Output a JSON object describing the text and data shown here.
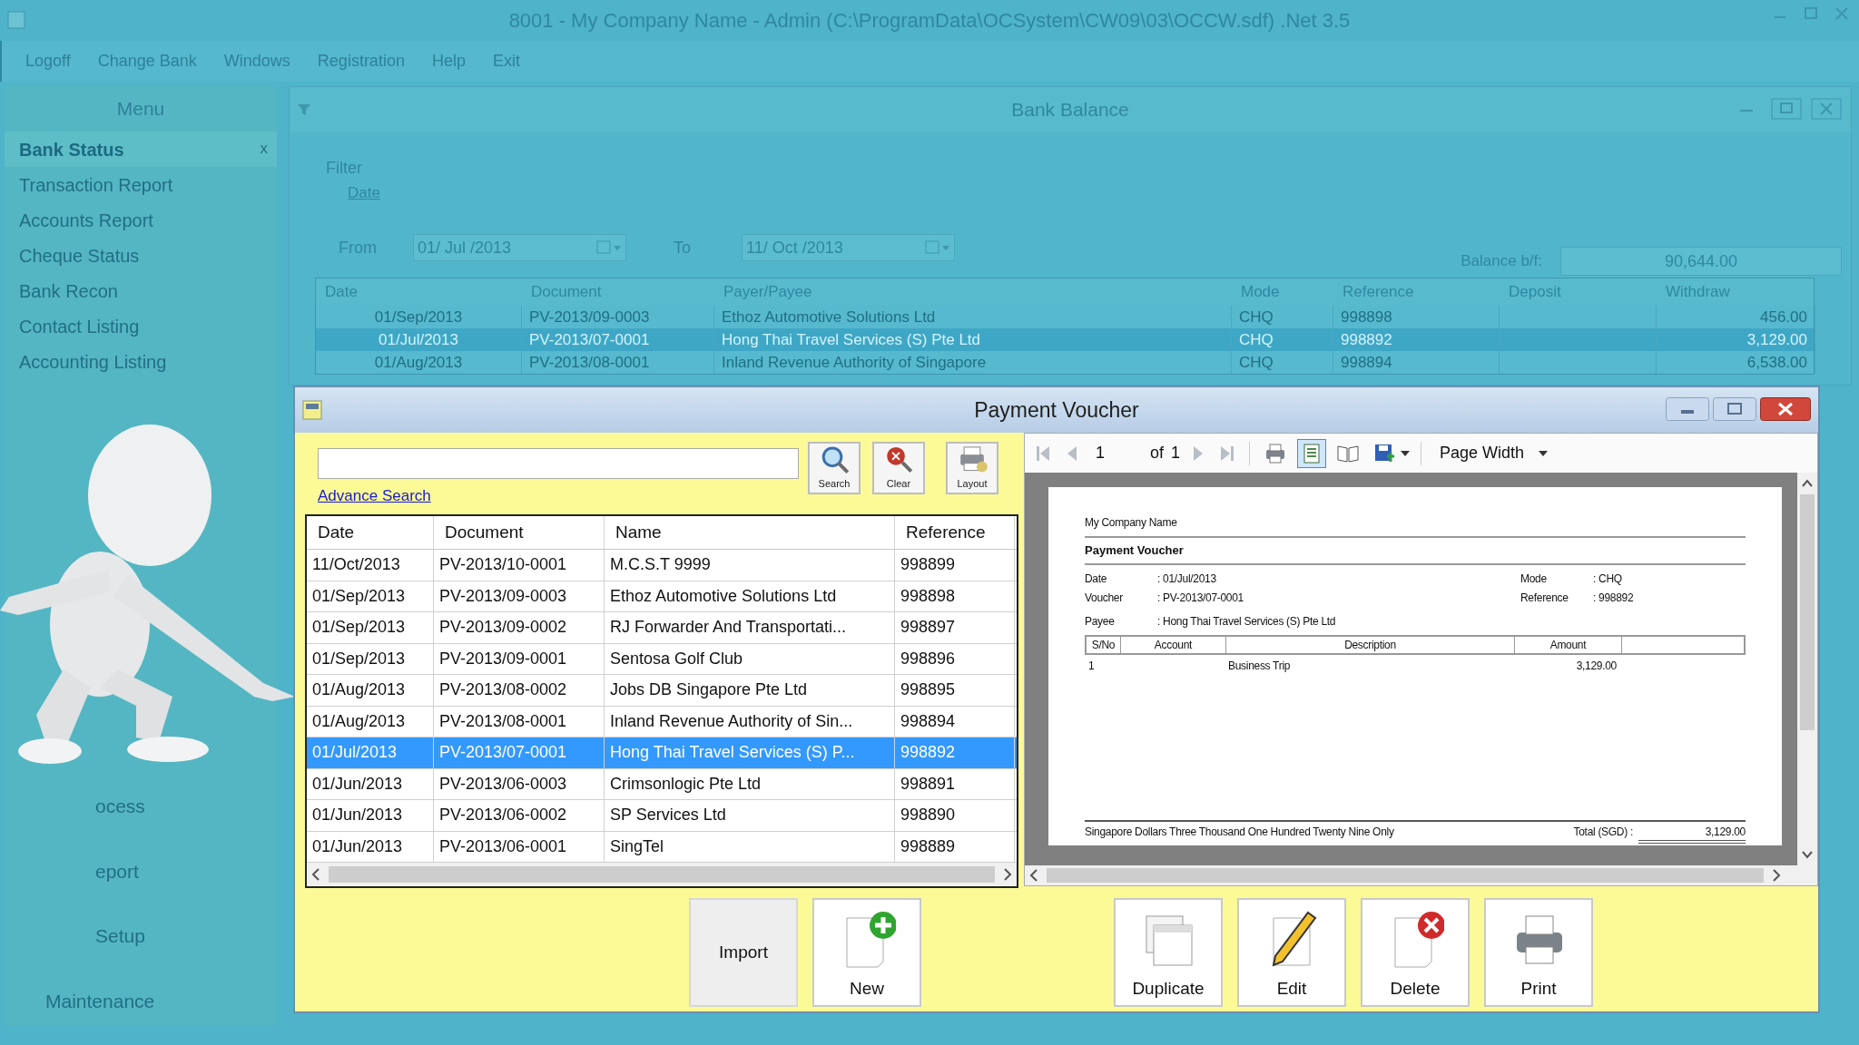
{
  "window": {
    "title": "8001 - My Company Name - Admin (C:\\ProgramData\\OCSystem\\CW09\\03\\OCCW.sdf) .Net 3.5"
  },
  "menu_bar": [
    "Logoff",
    "Change Bank",
    "Windows",
    "Registration",
    "Help",
    "Exit"
  ],
  "side_menu": {
    "title": "Menu",
    "close": "x",
    "items": [
      {
        "label": "Bank Status",
        "selected": true
      },
      {
        "label": "Transaction Report",
        "selected": false
      },
      {
        "label": "Accounts Report",
        "selected": false
      },
      {
        "label": "Cheque Status",
        "selected": false
      },
      {
        "label": "Bank Recon",
        "selected": false
      },
      {
        "label": "Contact Listing",
        "selected": false
      },
      {
        "label": "Accounting Listing",
        "selected": false
      }
    ],
    "groups": [
      "ocess",
      "eport",
      "Setup",
      "Maintenance"
    ]
  },
  "bank_balance": {
    "title": "Bank Balance",
    "filter_label": "Filter",
    "date_label": "Date",
    "from_label": "From",
    "from_value": "01/ Jul /2013",
    "to_label": "To",
    "to_value": "11/ Oct /2013",
    "balance_label": "Balance b/f:",
    "balance_value": "90,644.00",
    "columns": [
      "Date",
      "Document",
      "Payer/Payee",
      "Mode",
      "Reference",
      "Deposit",
      "Withdraw"
    ],
    "rows": [
      {
        "selected": false,
        "cells": {
          "date": "01/Sep/2013",
          "document": "PV-2013/09-0003",
          "payee": "Ethoz Automotive Solutions Ltd",
          "mode": "CHQ",
          "reference": "998898",
          "withdraw": "456.00"
        }
      },
      {
        "selected": true,
        "cells": {
          "date": "01/Jul/2013",
          "document": "PV-2013/07-0001",
          "payee": "Hong Thai Travel Services (S) Pte Ltd",
          "mode": "CHQ",
          "reference": "998892",
          "withdraw": "3,129.00"
        }
      },
      {
        "selected": false,
        "cells": {
          "date": "01/Aug/2013",
          "document": "PV-2013/08-0001",
          "payee": "Inland Revenue Authority of Singapore",
          "mode": "CHQ",
          "reference": "998894",
          "withdraw": "6,538.00"
        }
      }
    ]
  },
  "dialog": {
    "title": "Payment Voucher",
    "advance_search": "Advance Search",
    "tool_buttons": [
      {
        "label": "Search",
        "kind": "search"
      },
      {
        "label": "Clear",
        "kind": "clear"
      },
      {
        "label": "Layout",
        "kind": "layout"
      }
    ],
    "columns": [
      "Date",
      "Document",
      "Name",
      "Reference"
    ],
    "rows": [
      {
        "date": "11/Oct/2013",
        "document": "PV-2013/10-0001",
        "name": "M.C.S.T 9999",
        "reference": "998899",
        "selected": false
      },
      {
        "date": "01/Sep/2013",
        "document": "PV-2013/09-0003",
        "name": "Ethoz Automotive Solutions Ltd",
        "reference": "998898",
        "selected": false
      },
      {
        "date": "01/Sep/2013",
        "document": "PV-2013/09-0002",
        "name": "RJ Forwarder And Transportati...",
        "reference": "998897",
        "selected": false
      },
      {
        "date": "01/Sep/2013",
        "document": "PV-2013/09-0001",
        "name": "Sentosa Golf Club",
        "reference": "998896",
        "selected": false
      },
      {
        "date": "01/Aug/2013",
        "document": "PV-2013/08-0002",
        "name": "Jobs DB Singapore Pte Ltd",
        "reference": "998895",
        "selected": false
      },
      {
        "date": "01/Aug/2013",
        "document": "PV-2013/08-0001",
        "name": "Inland Revenue Authority of Sin...",
        "reference": "998894",
        "selected": false
      },
      {
        "date": "01/Jul/2013",
        "document": "PV-2013/07-0001",
        "name": "Hong Thai Travel Services (S) P...",
        "reference": "998892",
        "selected": true
      },
      {
        "date": "01/Jun/2013",
        "document": "PV-2013/06-0003",
        "name": "Crimsonlogic Pte Ltd",
        "reference": "998891",
        "selected": false
      },
      {
        "date": "01/Jun/2013",
        "document": "PV-2013/06-0002",
        "name": "SP Services Ltd",
        "reference": "998890",
        "selected": false
      },
      {
        "date": "01/Jun/2013",
        "document": "PV-2013/06-0001",
        "name": "SingTel",
        "reference": "998889",
        "selected": false
      }
    ],
    "viewer": {
      "page": "1",
      "of_label": "of",
      "page_count": "1",
      "zoom": "Page Width",
      "tools": [
        {
          "kind": "print",
          "selected": false
        },
        {
          "kind": "page-view",
          "selected": true
        },
        {
          "kind": "book",
          "selected": false
        },
        {
          "kind": "save",
          "selected": false
        }
      ],
      "report": {
        "company": "My Company Name",
        "title": "Payment Voucher",
        "left_fields": [
          {
            "label": "Date",
            "value": ": 01/Jul/2013"
          },
          {
            "label": "Voucher",
            "value": ": PV-2013/07-0001"
          }
        ],
        "right_fields": [
          {
            "label": "Mode",
            "value": ": CHQ"
          },
          {
            "label": "Reference",
            "value": ": 998892"
          }
        ],
        "payee": {
          "label": "Payee",
          "value": ": Hong Thai Travel Services (S) Pte Ltd"
        },
        "columns": [
          "S/No",
          "Account",
          "Description",
          "Amount"
        ],
        "lines": [
          {
            "sno": "1",
            "description": "Business Trip",
            "amount": "3,129.00"
          }
        ],
        "amount_words": "Singapore Dollars Three Thousand One Hundred Twenty Nine Only",
        "total_label": "Total (SGD) :",
        "total": "3,129.00"
      }
    },
    "actions": [
      {
        "label": "Import",
        "kind": "import"
      },
      {
        "label": "New",
        "kind": "new"
      },
      {
        "label": "Duplicate",
        "kind": "duplicate"
      },
      {
        "label": "Edit",
        "kind": "edit"
      },
      {
        "label": "Delete",
        "kind": "delete"
      },
      {
        "label": "Print",
        "kind": "print"
      }
    ]
  }
}
